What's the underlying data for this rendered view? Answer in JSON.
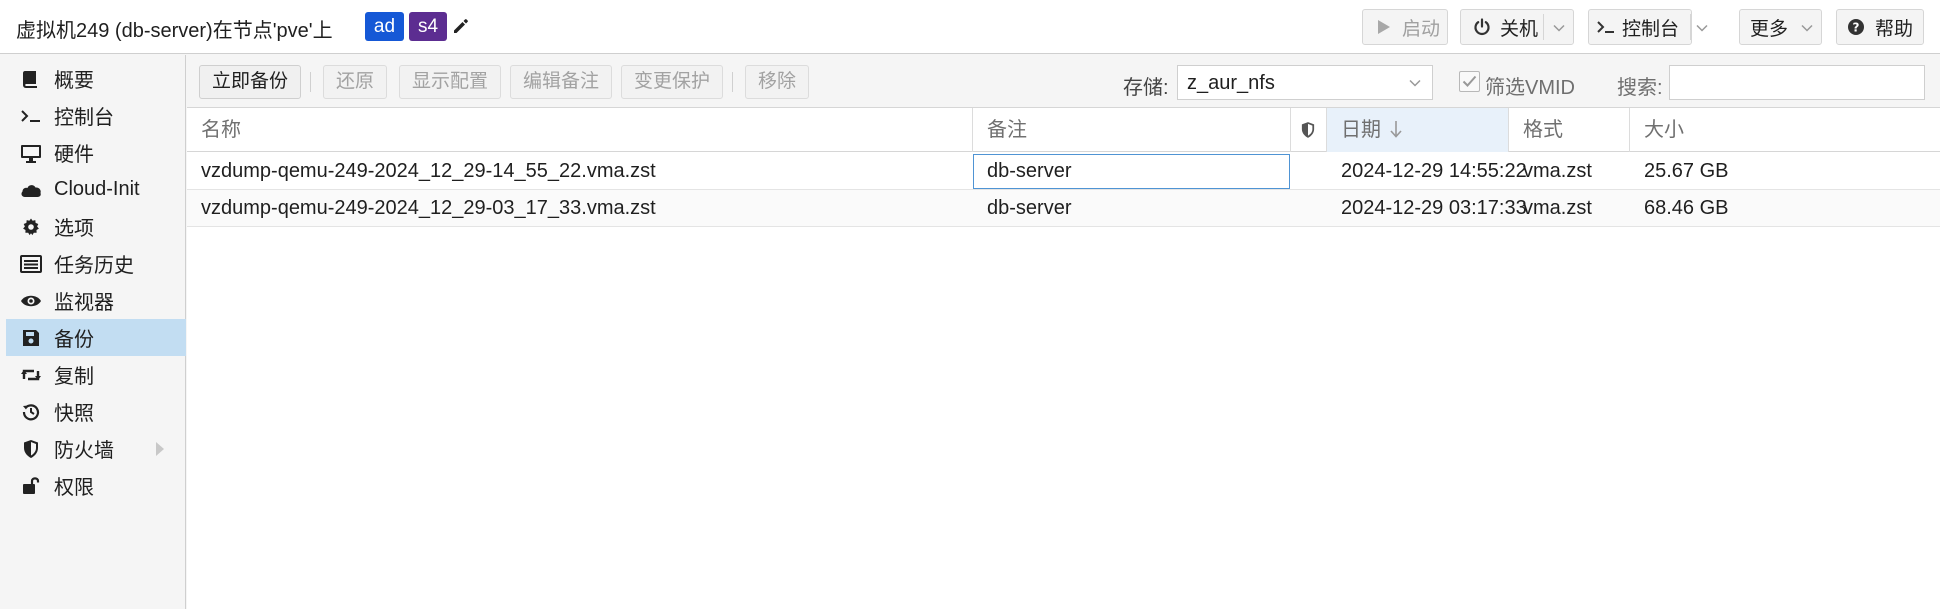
{
  "header": {
    "title": "虚拟机249 (db-server)在节点'pve'上",
    "tags": [
      "ad",
      "s4"
    ],
    "buttons": {
      "start": "启动",
      "shutdown": "关机",
      "console": "控制台",
      "more": "更多",
      "help": "帮助"
    }
  },
  "sidebar": {
    "items": [
      {
        "label": "概要",
        "icon": "book-icon"
      },
      {
        "label": "控制台",
        "icon": "terminal-icon"
      },
      {
        "label": "硬件",
        "icon": "desktop-icon"
      },
      {
        "label": "Cloud-Init",
        "icon": "cloud-icon"
      },
      {
        "label": "选项",
        "icon": "gear-icon"
      },
      {
        "label": "任务历史",
        "icon": "list-icon"
      },
      {
        "label": "监视器",
        "icon": "eye-icon"
      },
      {
        "label": "备份",
        "icon": "floppy-icon"
      },
      {
        "label": "复制",
        "icon": "retweet-icon"
      },
      {
        "label": "快照",
        "icon": "history-icon"
      },
      {
        "label": "防火墙",
        "icon": "shield-icon"
      },
      {
        "label": "权限",
        "icon": "unlock-icon"
      }
    ],
    "active": "备份"
  },
  "toolbar": {
    "backup_now": "立即备份",
    "restore": "还原",
    "show_config": "显示配置",
    "edit_notes": "编辑备注",
    "change_protection": "变更保护",
    "remove": "移除",
    "storage_label": "存储:",
    "storage_value": "z_aur_nfs",
    "filter_vmid_label": "筛选VMID",
    "filter_vmid_checked": true,
    "search_label": "搜索:",
    "search_value": ""
  },
  "grid": {
    "columns": {
      "name": "名称",
      "notes": "备注",
      "date": "日期",
      "format": "格式",
      "size": "大小"
    },
    "sort": {
      "column": "日期",
      "direction": "descending"
    },
    "rows": [
      {
        "name": "vzdump-qemu-249-2024_12_29-14_55_22.vma.zst",
        "notes": "db-server",
        "date": "2024-12-29 14:55:22",
        "format": "vma.zst",
        "size": "25.67 GB"
      },
      {
        "name": "vzdump-qemu-249-2024_12_29-03_17_33.vma.zst",
        "notes": "db-server",
        "date": "2024-12-29 03:17:33",
        "format": "vma.zst",
        "size": "68.46 GB"
      }
    ]
  },
  "colors": {
    "tag_ad": "#1558d6",
    "tag_s4": "#5c2d91",
    "active_nav": "#c2ddf2",
    "sorted_header": "#e8f1fa",
    "edit_border": "#4f94d4"
  }
}
